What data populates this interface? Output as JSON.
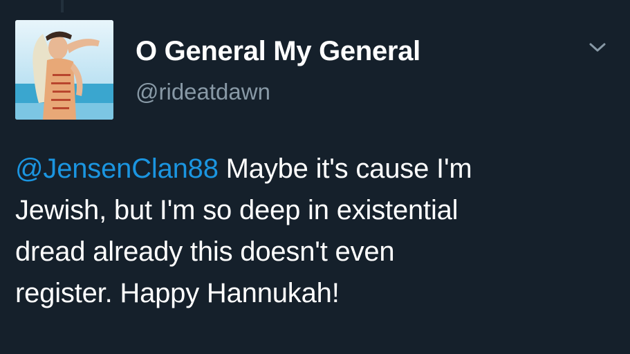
{
  "tweet": {
    "display_name": "O General My General",
    "handle": "@rideatdawn",
    "mention": "@JensenClan88",
    "lines": [
      " Maybe it's cause I'm",
      "Jewish, but I'm so deep in existential",
      "dread already this doesn't even",
      "register. Happy Hannukah!"
    ]
  },
  "icons": {
    "avatar": "profile-avatar-image",
    "menu": "chevron-down-icon"
  },
  "colors": {
    "background": "#15202b",
    "mention": "#1b95e0",
    "handle": "#8899a6",
    "text": "#ffffff"
  }
}
